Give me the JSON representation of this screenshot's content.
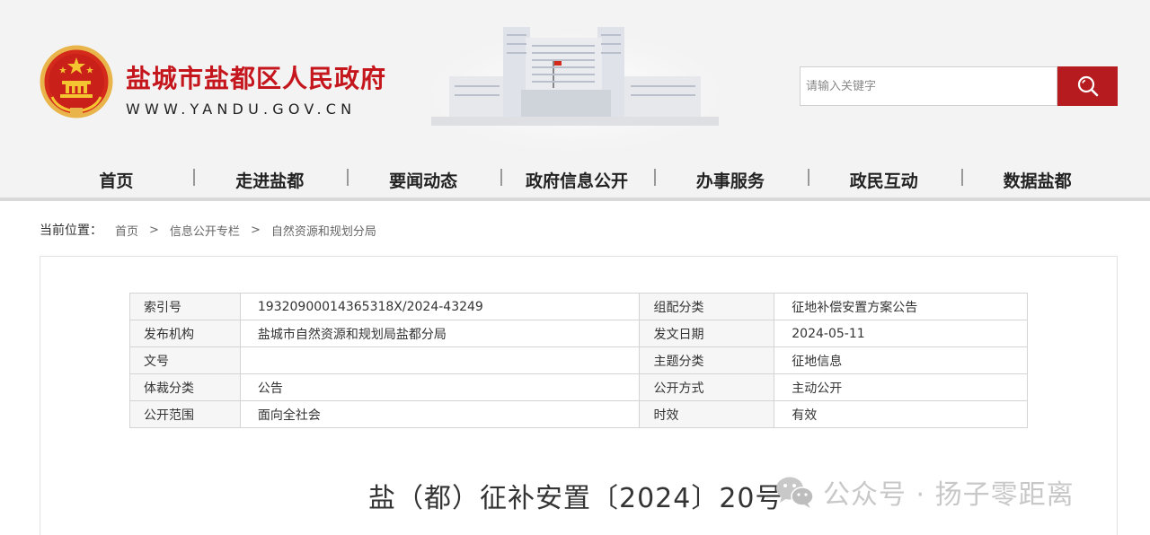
{
  "header": {
    "site_title": "盐城市盐都区人民政府",
    "site_url": "WWW.YANDU.GOV.CN",
    "search_placeholder": "请输入关键字"
  },
  "nav": {
    "items": [
      "首页",
      "走进盐都",
      "要闻动态",
      "政府信息公开",
      "办事服务",
      "政民互动",
      "数据盐都"
    ]
  },
  "breadcrumb": {
    "label": "当前位置：",
    "items": [
      "首页",
      "信息公开专栏",
      "自然资源和规划分局"
    ],
    "separator": ">"
  },
  "info_table": {
    "rows": [
      [
        {
          "k": "索引号",
          "v": "19320900014365318X/2024-43249"
        },
        {
          "k": "组配分类",
          "v": "征地补偿安置方案公告"
        }
      ],
      [
        {
          "k": "发布机构",
          "v": "盐城市自然资源和规划局盐都分局"
        },
        {
          "k": "发文日期",
          "v": "2024-05-11"
        }
      ],
      [
        {
          "k": "文号",
          "v": ""
        },
        {
          "k": "主题分类",
          "v": "征地信息"
        }
      ],
      [
        {
          "k": "体裁分类",
          "v": "公告"
        },
        {
          "k": "公开方式",
          "v": "主动公开"
        }
      ],
      [
        {
          "k": "公开范围",
          "v": "面向全社会"
        },
        {
          "k": "时效",
          "v": "有效"
        }
      ]
    ]
  },
  "document": {
    "title": "盐（都）征补安置〔2024〕20号"
  },
  "watermark": {
    "text": "公众号 · 扬子零距离"
  },
  "colors": {
    "brand_red": "#c4161c",
    "search_button": "#b61b1f",
    "header_bg": "#f3f3f3"
  },
  "icons": [
    "national-emblem-icon",
    "search-icon",
    "wechat-icon"
  ]
}
